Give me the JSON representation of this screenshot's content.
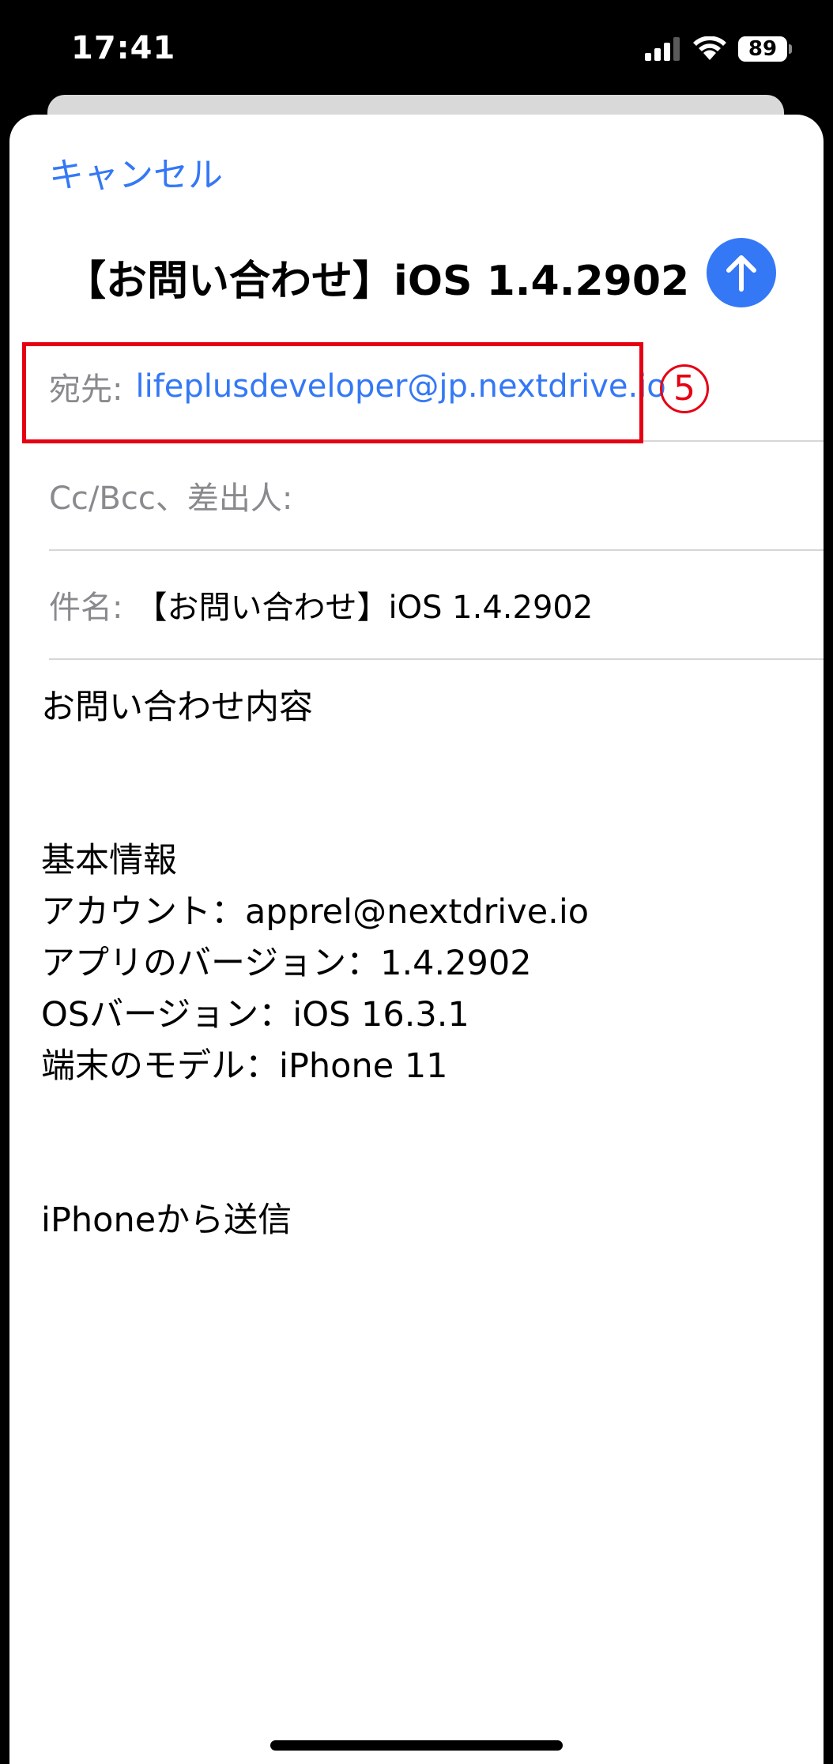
{
  "status_bar": {
    "time": "17:41",
    "battery": "89"
  },
  "header": {
    "cancel_label": "キャンセル",
    "title": "【お問い合わせ】iOS 1.4.2902"
  },
  "fields": {
    "to_label": "宛先:",
    "to_value": "lifeplusdeveloper@jp.nextdrive.io",
    "ccbcc_label": "Cc/Bcc、差出人:",
    "subject_label": "件名:",
    "subject_value": "【お問い合わせ】iOS 1.4.2902"
  },
  "annotation": {
    "step_marker": "5",
    "highlight_color": "#e60012"
  },
  "body": {
    "lines": [
      "お問い合わせ内容",
      "基本情報",
      "アカウント：apprel@nextdrive.io",
      "アプリのバージョン：1.4.2902",
      "OSバージョン：iOS 16.3.1",
      "端末のモデル：iPhone 11",
      "iPhoneから送信"
    ]
  },
  "colors": {
    "accent": "#3478f6",
    "label_gray": "#8a8a8e"
  },
  "icons": {
    "signal": "cellular-signal-icon",
    "wifi": "wifi-icon",
    "send": "arrow-up-icon"
  }
}
